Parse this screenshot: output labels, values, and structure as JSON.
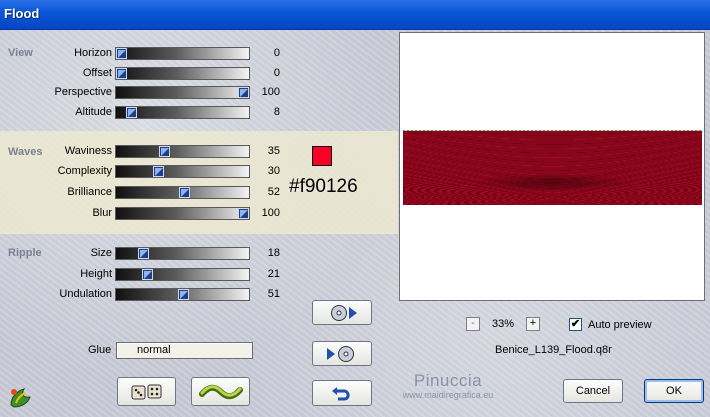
{
  "window": {
    "title": "Flood"
  },
  "sections": {
    "view": {
      "title": "View"
    },
    "waves": {
      "title": "Waves"
    },
    "ripple": {
      "title": "Ripple"
    }
  },
  "sliders": [
    {
      "label": "Horizon",
      "value": "0",
      "fraction": 0.0
    },
    {
      "label": "Offset",
      "value": "0",
      "fraction": 0.0
    },
    {
      "label": "Perspective",
      "value": "100",
      "fraction": 1.0
    },
    {
      "label": "Altitude",
      "value": "8",
      "fraction": 0.08
    },
    {
      "label": "Waviness",
      "value": "35",
      "fraction": 0.35
    },
    {
      "label": "Complexity",
      "value": "30",
      "fraction": 0.3
    },
    {
      "label": "Brilliance",
      "value": "52",
      "fraction": 0.52
    },
    {
      "label": "Blur",
      "value": "100",
      "fraction": 1.0
    },
    {
      "label": "Size",
      "value": "18",
      "fraction": 0.18
    },
    {
      "label": "Height",
      "value": "21",
      "fraction": 0.21
    },
    {
      "label": "Undulation",
      "value": "51",
      "fraction": 0.51
    }
  ],
  "color": {
    "hex": "#f90126"
  },
  "glue": {
    "label": "Glue",
    "value": "normal"
  },
  "preview": {
    "zoom": "33%",
    "zoom_minus": "-",
    "zoom_plus": "+",
    "auto_preview_label": "Auto preview",
    "auto_preview_checked": "✔",
    "filename": "Benice_L139_Flood.q8r"
  },
  "buttons": {
    "cancel": "Cancel",
    "ok": "OK"
  },
  "watermark": {
    "name": "Pinuccia",
    "url": "www.maidiregrafica.eu"
  },
  "icons": {
    "randomize": "dice-icon",
    "reset": "wave-icon",
    "preset_save": "disc-arrow-icon",
    "preset_load": "arrow-disc-icon",
    "undo": "undo-arrow-icon",
    "logo": "app-logo-icon"
  },
  "colors": {
    "titlebar": "#0b57d8",
    "section_title": "#7b8194",
    "waves_band": "#ece9d0",
    "flood_red": "#b8102a"
  }
}
